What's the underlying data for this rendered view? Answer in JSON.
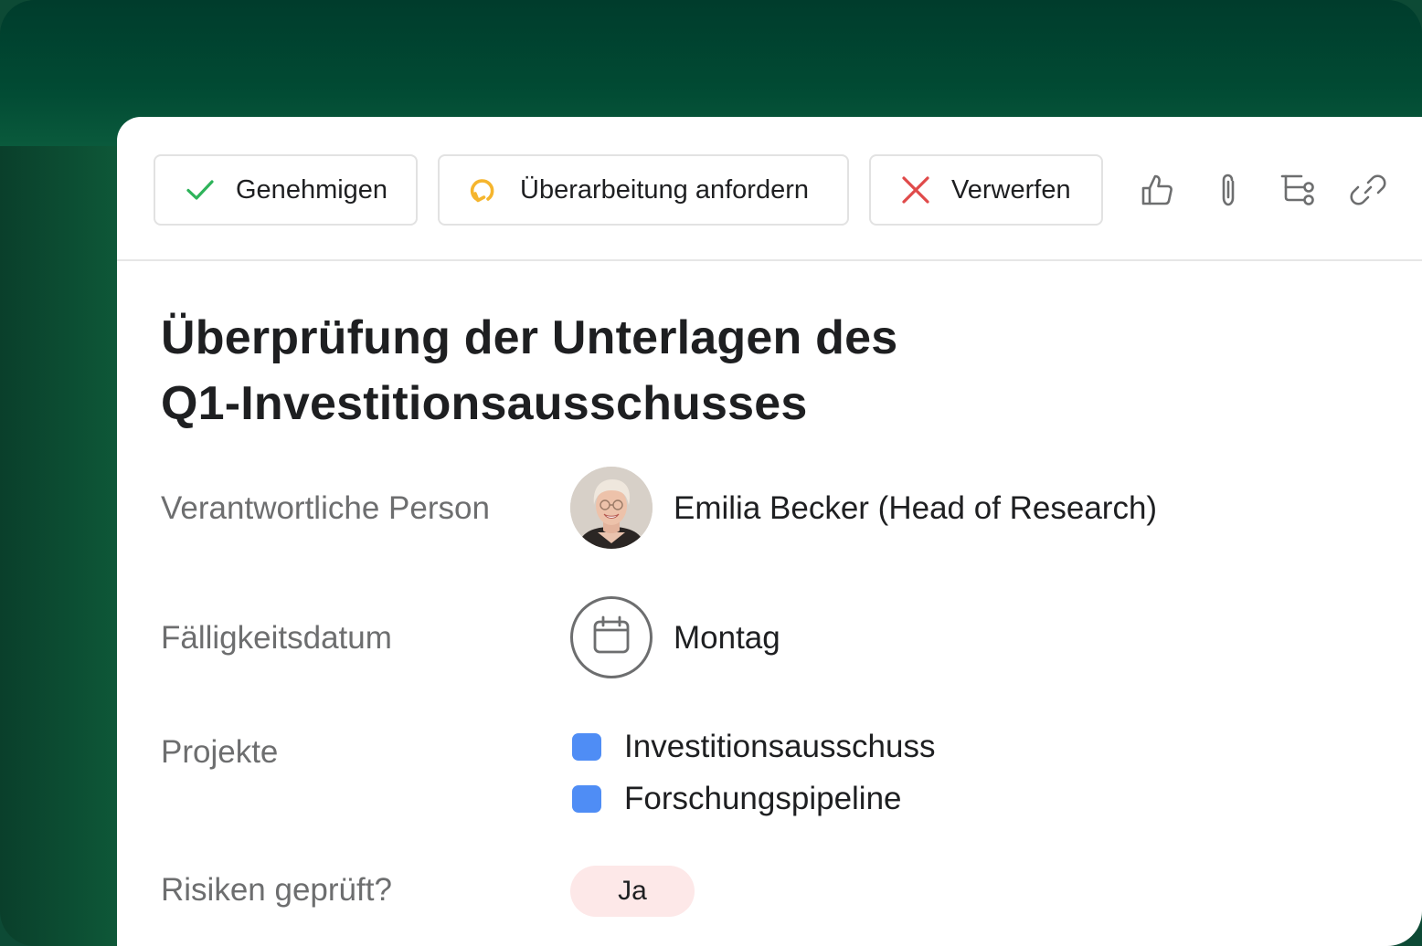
{
  "toolbar": {
    "approve_label": "Genehmigen",
    "revise_label": "Überarbeitung anfordern",
    "reject_label": "Verwerfen",
    "icons": [
      "thumbs-up-icon",
      "paperclip-icon",
      "subtask-icon",
      "link-icon"
    ]
  },
  "task": {
    "title_line1": "Überprüfung der Unterlagen des",
    "title_line2": "Q1-Investitionsausschusses"
  },
  "fields": {
    "assignee_label": "Verantwortliche Person",
    "assignee_value": "Emilia Becker (Head of Research)",
    "due_label": "Fälligkeitsdatum",
    "due_value": "Montag",
    "projects_label": "Projekte",
    "projects": [
      {
        "name": "Investitionsausschuss",
        "color": "#4f8df5"
      },
      {
        "name": "Forschungspipeline",
        "color": "#4f8df5"
      }
    ],
    "risks_label": "Risiken geprüft?",
    "risks_value": "Ja"
  },
  "colors": {
    "background": "#02402e",
    "approve": "#2eb35a",
    "revise": "#f5b52e",
    "reject": "#e04a4a",
    "badge": "#fde8e8"
  }
}
